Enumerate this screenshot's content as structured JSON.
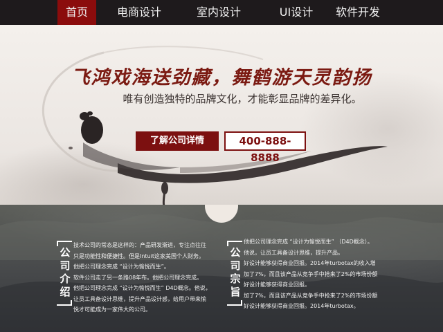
{
  "nav": {
    "items": [
      {
        "label": "首页",
        "active": true
      },
      {
        "label": "电商设计",
        "active": false
      },
      {
        "label": "室内设计",
        "active": false
      },
      {
        "label": "UI设计",
        "active": false
      },
      {
        "label": "软件开发",
        "active": false
      }
    ]
  },
  "hero": {
    "headline": "飞鸿戏海送劲藏，舞鹤游天灵韵扬",
    "subline": "唯有创造独特的品牌文化，才能彰显品牌的差异化。",
    "cta_label": "了解公司详情",
    "phone": "400-888-8888"
  },
  "intro": {
    "title": "公司介绍",
    "lines": [
      "技术公司的常态是这样的：产品研发渐进，专注点往往",
      "只是功能性和便捷性。但是Intuit这家美国个人财务。",
      "他把公司理念完成 “设计为愉悦而生”。",
      "软件公司走了另一条路08年布。他把公司理念完成。",
      "他把公司理念完成 “设计为愉悦而生” D4D概念。他说，",
      "让员工具备设计思维，提升产品设计感，给用户带来愉",
      "悦才可能成为一家伟大的公司。"
    ]
  },
  "tenet": {
    "title": "公司宗旨",
    "lines": [
      "他把公司理念完成 “设计为愉悦而生” （D4D概念）。",
      "他说，让员工具备设计思维，提升产品。",
      "好设计能够获得商业回报。2014年turbotax的收入增",
      "加了7%，而且该产品从竞争手中抢来了2%的市场份额",
      "好设计能够获得商业回报。",
      "加了7%，而且该产品从竞争手中抢来了2%的市场份额",
      "好设计能够获得商业回报。2014年turbotax。"
    ]
  },
  "colors": {
    "nav_bg": "#1e1a1c",
    "accent": "#8b0c0c",
    "headline": "#7b1a12"
  }
}
